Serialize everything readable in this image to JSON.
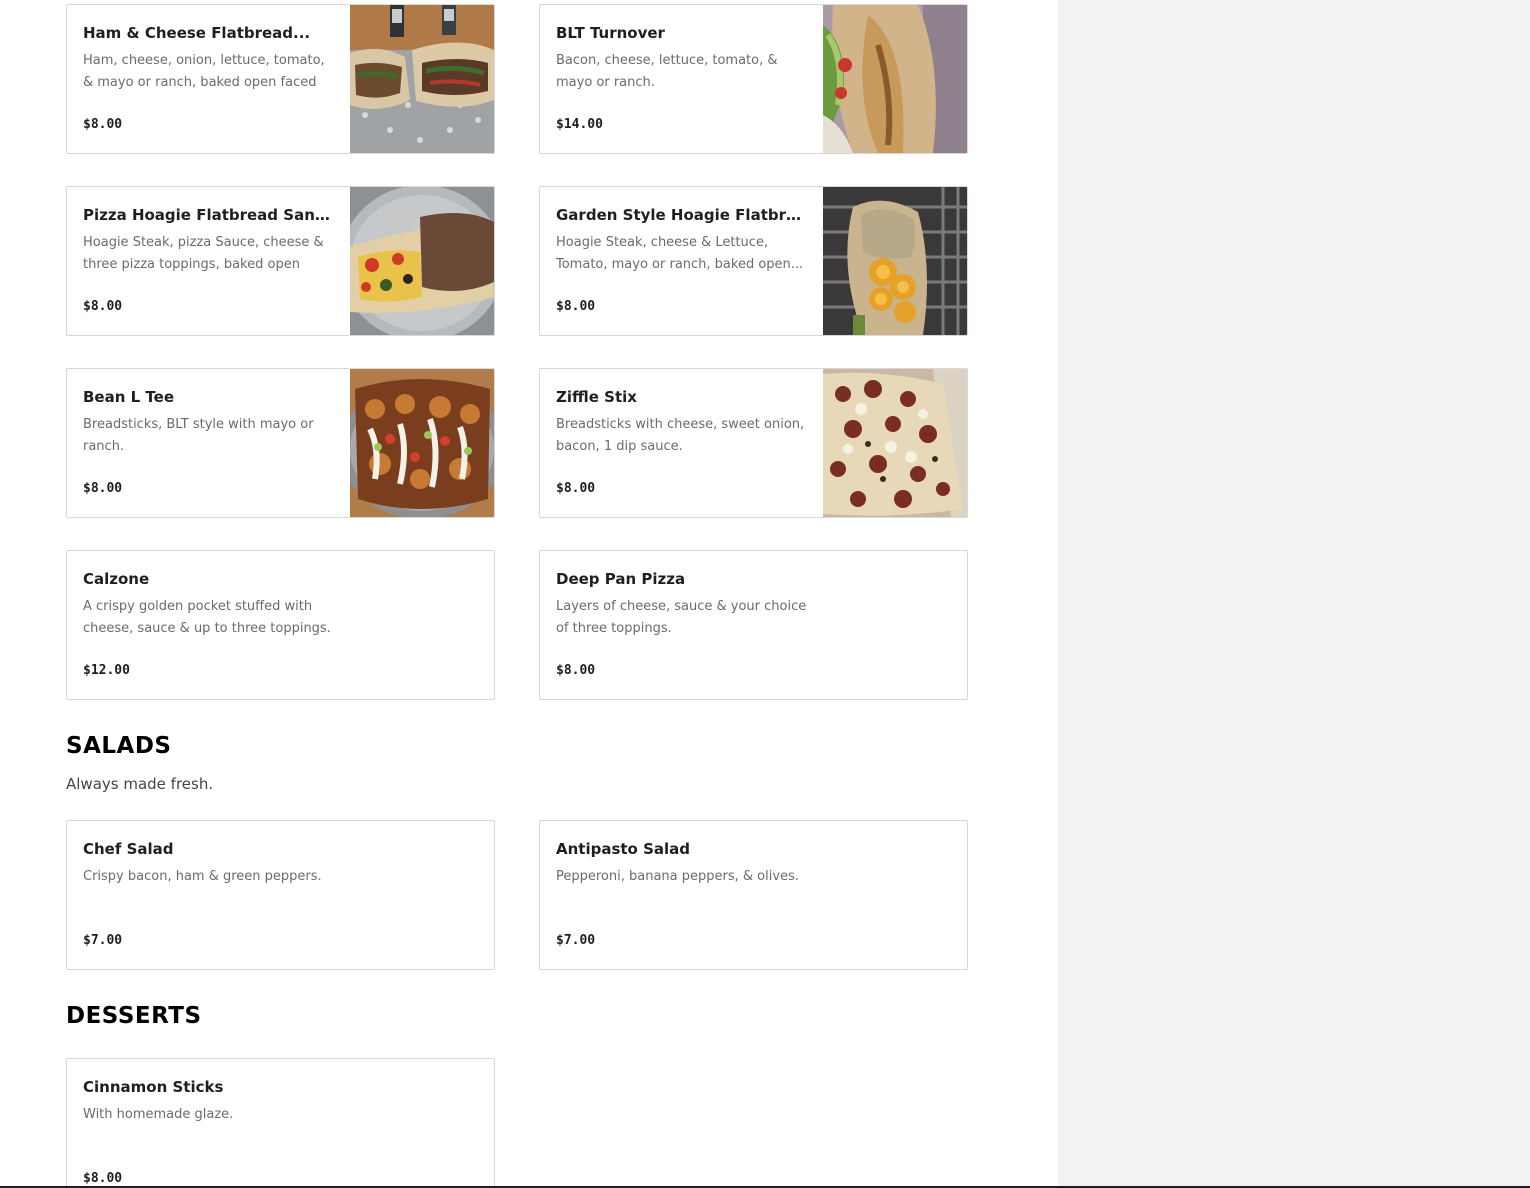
{
  "menu": {
    "items": [
      {
        "title": "Ham & Cheese Flatbread...",
        "description": "Ham, cheese, onion, lettuce, tomato, & mayo or ranch, baked open faced the...",
        "price": "$8.00",
        "photo": "ham-cheese-flatbread-photo"
      },
      {
        "title": "BLT Turnover",
        "description": "Bacon, cheese, lettuce, tomato, & mayo or ranch.",
        "price": "$14.00",
        "photo": "blt-turnover-photo"
      },
      {
        "title": "Pizza Hoagie Flatbread Sandwich",
        "description": "Hoagie Steak, pizza Sauce, cheese & three pizza toppings, baked open face...",
        "price": "$8.00",
        "photo": "pizza-hoagie-photo"
      },
      {
        "title": "Garden Style Hoagie Flatbread...",
        "description": "Hoagie Steak, cheese & Lettuce, Tomato, mayo or ranch, baked open...",
        "price": "$8.00",
        "photo": "garden-hoagie-photo"
      },
      {
        "title": "Bean L Tee",
        "description": "Breadsticks, BLT style with mayo or ranch.",
        "price": "$8.00",
        "photo": "bean-l-tee-photo"
      },
      {
        "title": "Ziffle Stix",
        "description": "Breadsticks with cheese, sweet onion, bacon, 1 dip sauce.",
        "price": "$8.00",
        "photo": "ziffle-stix-photo"
      },
      {
        "title": "Calzone",
        "description": "A crispy golden pocket stuffed with cheese, sauce & up to three toppings.",
        "price": "$12.00"
      },
      {
        "title": "Deep Pan Pizza",
        "description": "Layers of cheese, sauce & your choice of three toppings.",
        "price": "$8.00"
      }
    ]
  },
  "salads": {
    "title": "SALADS",
    "subtitle": "Always made fresh.",
    "items": [
      {
        "title": "Chef Salad",
        "description": "Crispy bacon, ham & green peppers.",
        "price": "$7.00"
      },
      {
        "title": "Antipasto Salad",
        "description": "Pepperoni, banana peppers, & olives.",
        "price": "$7.00"
      }
    ]
  },
  "desserts": {
    "title": "DESSERTS",
    "items": [
      {
        "title": "Cinnamon Sticks",
        "description": "With homemade glaze.",
        "price": "$8.00"
      }
    ]
  },
  "colors": {
    "side_panel": "#f3f2f0",
    "card_border": "#d8d8d8",
    "description_text": "#6b6b6b"
  }
}
